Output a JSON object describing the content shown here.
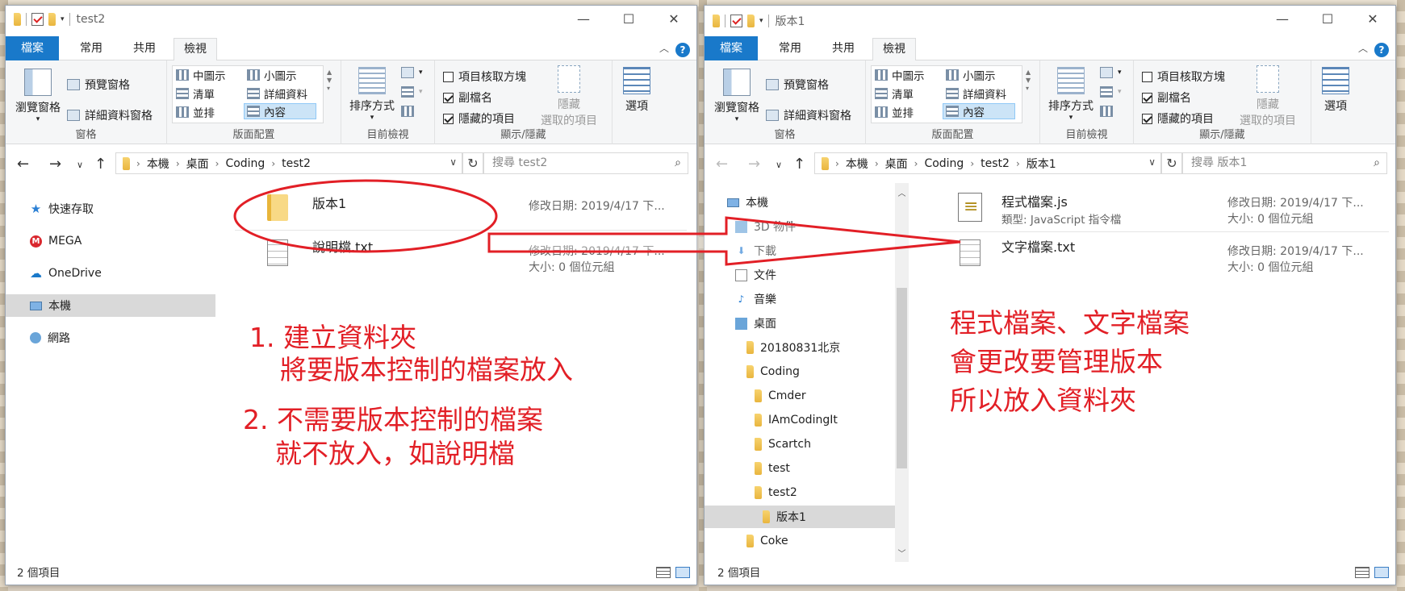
{
  "left": {
    "title": "test2",
    "tabs": {
      "file": "檔案",
      "home": "常用",
      "share": "共用",
      "view": "檢視"
    },
    "ribbon": {
      "panes": {
        "nav_pane": "瀏覽窗格",
        "preview": "預覽窗格",
        "details": "詳細資料窗格",
        "label": "窗格"
      },
      "layout": {
        "medium": "中圖示",
        "small": "小圖示",
        "list": "清單",
        "details": "詳細資料",
        "tiles": "並排",
        "content": "內容",
        "label": "版面配置"
      },
      "current": {
        "sort": "排序方式",
        "label": "目前檢視"
      },
      "showhide": {
        "checkboxes": "項目核取方塊",
        "extensions": "副檔名",
        "hidden": "隱藏的項目",
        "hide_sel": "隱藏",
        "hide_sel2": "選取的項目",
        "options": "選項",
        "label": "顯示/隱藏"
      }
    },
    "breadcrumb": [
      "本機",
      "桌面",
      "Coding",
      "test2"
    ],
    "search_placeholder": "搜尋 test2",
    "nav": [
      "快速存取",
      "MEGA",
      "OneDrive",
      "本機",
      "網路"
    ],
    "files": [
      {
        "name": "版本1",
        "meta": "修改日期: 2019/4/17 下...",
        "sub": ""
      },
      {
        "name": "說明檔.txt",
        "meta": "修改日期: 2019/4/17 下...",
        "meta2": "大小: 0 個位元組"
      }
    ],
    "status": "2 個項目",
    "notes": [
      "1. 建立資料夾",
      "將要版本控制的檔案放入",
      "2. 不需要版本控制的檔案",
      "就不放入，如說明檔"
    ]
  },
  "right": {
    "title": "版本1",
    "tabs": {
      "file": "檔案",
      "home": "常用",
      "share": "共用",
      "view": "檢視"
    },
    "ribbon": {
      "panes": {
        "nav_pane": "瀏覽窗格",
        "preview": "預覽窗格",
        "details": "詳細資料窗格",
        "label": "窗格"
      },
      "layout": {
        "medium": "中圖示",
        "small": "小圖示",
        "list": "清單",
        "details": "詳細資料",
        "tiles": "並排",
        "content": "內容",
        "label": "版面配置"
      },
      "current": {
        "sort": "排序方式",
        "label": "目前檢視"
      },
      "showhide": {
        "checkboxes": "項目核取方塊",
        "extensions": "副檔名",
        "hidden": "隱藏的項目",
        "hide_sel": "隱藏",
        "hide_sel2": "選取的項目",
        "options": "選項",
        "label": "顯示/隱藏"
      }
    },
    "breadcrumb": [
      "本機",
      "桌面",
      "Coding",
      "test2",
      "版本1"
    ],
    "search_placeholder": "搜尋 版本1",
    "nav": [
      "本機",
      "3D 物件",
      "下載",
      "文件",
      "音樂",
      "桌面",
      "20180831北京",
      "Coding",
      "Cmder",
      "IAmCodingIt",
      "Scartch",
      "test",
      "test2",
      "版本1",
      "Coke"
    ],
    "files": [
      {
        "name": "程式檔案.js",
        "sub": "類型: JavaScript 指令檔",
        "meta": "修改日期: 2019/4/17 下...",
        "meta2": "大小: 0 個位元組"
      },
      {
        "name": "文字檔案.txt",
        "meta": "修改日期: 2019/4/17 下...",
        "meta2": "大小: 0 個位元組"
      }
    ],
    "status": "2 個項目",
    "notes": [
      "程式檔案、文字檔案",
      "會更改要管理版本",
      "所以放入資料夾"
    ]
  },
  "colors": {
    "accent": "#1979ca",
    "annotation": "#e21f26",
    "folder": "#f0c75a"
  }
}
